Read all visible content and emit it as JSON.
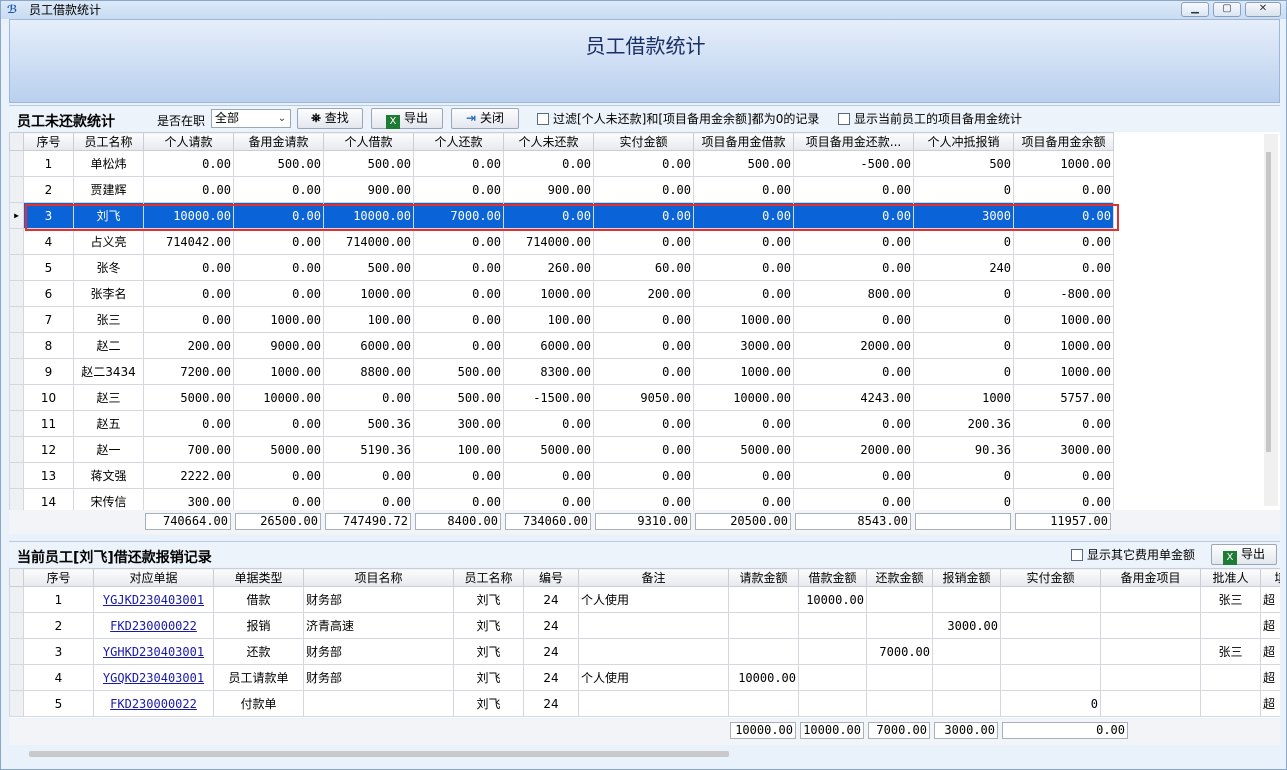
{
  "window": {
    "title": "员工借款统计"
  },
  "banner": {
    "title": "员工借款统计"
  },
  "top": {
    "section_title": "员工未还款统计",
    "filter_label": "是否在职",
    "filter_value": "全部",
    "search_label": "查找",
    "export_label": "导出",
    "close_label": "关闭",
    "filter_zero_label": "过滤[个人未还款]和[项目备用金余额]都为0的记录",
    "show_project_label": "显示当前员工的项目备用金统计",
    "columns": [
      "序号",
      "员工名称",
      "个人请款",
      "备用金请款",
      "个人借款",
      "个人还款",
      "个人未还款",
      "实付金额",
      "项目备用金借款",
      "项目备用金还款...",
      "个人冲抵报销",
      "项目备用金余额"
    ],
    "rows": [
      [
        "1",
        "单松炜",
        "0.00",
        "500.00",
        "500.00",
        "0.00",
        "0.00",
        "0.00",
        "500.00",
        "-500.00",
        "500",
        "1000.00"
      ],
      [
        "2",
        "贾建辉",
        "0.00",
        "0.00",
        "900.00",
        "0.00",
        "900.00",
        "0.00",
        "0.00",
        "0.00",
        "0",
        "0.00"
      ],
      [
        "3",
        "刘飞",
        "10000.00",
        "0.00",
        "10000.00",
        "7000.00",
        "0.00",
        "0.00",
        "0.00",
        "0.00",
        "3000",
        "0.00"
      ],
      [
        "4",
        "占义亮",
        "714042.00",
        "0.00",
        "714000.00",
        "0.00",
        "714000.00",
        "0.00",
        "0.00",
        "0.00",
        "0",
        "0.00"
      ],
      [
        "5",
        "张冬",
        "0.00",
        "0.00",
        "500.00",
        "0.00",
        "260.00",
        "60.00",
        "0.00",
        "0.00",
        "240",
        "0.00"
      ],
      [
        "6",
        "张李名",
        "0.00",
        "0.00",
        "1000.00",
        "0.00",
        "1000.00",
        "200.00",
        "0.00",
        "800.00",
        "0",
        "-800.00"
      ],
      [
        "7",
        "张三",
        "0.00",
        "1000.00",
        "100.00",
        "0.00",
        "100.00",
        "0.00",
        "1000.00",
        "0.00",
        "0",
        "1000.00"
      ],
      [
        "8",
        "赵二",
        "200.00",
        "9000.00",
        "6000.00",
        "0.00",
        "6000.00",
        "0.00",
        "3000.00",
        "2000.00",
        "0",
        "1000.00"
      ],
      [
        "9",
        "赵二3434",
        "7200.00",
        "1000.00",
        "8800.00",
        "500.00",
        "8300.00",
        "0.00",
        "1000.00",
        "0.00",
        "0",
        "1000.00"
      ],
      [
        "10",
        "赵三",
        "5000.00",
        "10000.00",
        "0.00",
        "500.00",
        "-1500.00",
        "9050.00",
        "10000.00",
        "4243.00",
        "1000",
        "5757.00"
      ],
      [
        "11",
        "赵五",
        "0.00",
        "0.00",
        "500.36",
        "300.00",
        "0.00",
        "0.00",
        "0.00",
        "0.00",
        "200.36",
        "0.00"
      ],
      [
        "12",
        "赵一",
        "700.00",
        "5000.00",
        "5190.36",
        "100.00",
        "5000.00",
        "0.00",
        "5000.00",
        "2000.00",
        "90.36",
        "3000.00"
      ],
      [
        "13",
        "蒋文强",
        "2222.00",
        "0.00",
        "0.00",
        "0.00",
        "0.00",
        "0.00",
        "0.00",
        "0.00",
        "0",
        "0.00"
      ],
      [
        "14",
        "宋传信",
        "300.00",
        "0.00",
        "0.00",
        "0.00",
        "0.00",
        "0.00",
        "0.00",
        "0.00",
        "0",
        "0.00"
      ]
    ],
    "selected_row": 2,
    "totals": [
      "740664.00",
      "26500.00",
      "747490.72",
      "8400.00",
      "734060.00",
      "9310.00",
      "20500.00",
      "8543.00",
      "",
      "11957.00"
    ]
  },
  "bottom": {
    "section_title": "当前员工[刘飞]借还款报销记录",
    "show_other_label": "显示其它费用单金额",
    "export_label": "导出",
    "columns": [
      "序号",
      "对应单据",
      "单据类型",
      "项目名称",
      "员工名称",
      "编号",
      "备注",
      "请款金额",
      "借款金额",
      "还款金额",
      "报销金额",
      "实付金额",
      "备用金项目",
      "批准人",
      "填"
    ],
    "rows": [
      [
        "1",
        "YGJKD230403001",
        "借款",
        "财务部",
        "刘飞",
        "24",
        "个人使用",
        "",
        "10000.00",
        "",
        "",
        "",
        "",
        "张三",
        "超"
      ],
      [
        "2",
        "FKD230000022",
        "报销",
        "济青高速",
        "刘飞",
        "24",
        "",
        "",
        "",
        "",
        "3000.00",
        "",
        "",
        "",
        "超"
      ],
      [
        "3",
        "YGHKD230403001",
        "还款",
        "财务部",
        "刘飞",
        "24",
        "",
        "",
        "",
        "7000.00",
        "",
        "",
        "",
        "张三",
        "超"
      ],
      [
        "4",
        "YGQKD230403001",
        "员工请款单",
        "财务部",
        "刘飞",
        "24",
        "个人使用",
        "10000.00",
        "",
        "",
        "",
        "",
        "",
        "",
        "超"
      ],
      [
        "5",
        "FKD230000022",
        "付款单",
        "",
        "刘飞",
        "24",
        "",
        "",
        "",
        "",
        "",
        "0",
        "",
        "",
        "超"
      ]
    ],
    "totals": [
      "10000.00",
      "10000.00",
      "7000.00",
      "3000.00",
      "0.00"
    ]
  }
}
